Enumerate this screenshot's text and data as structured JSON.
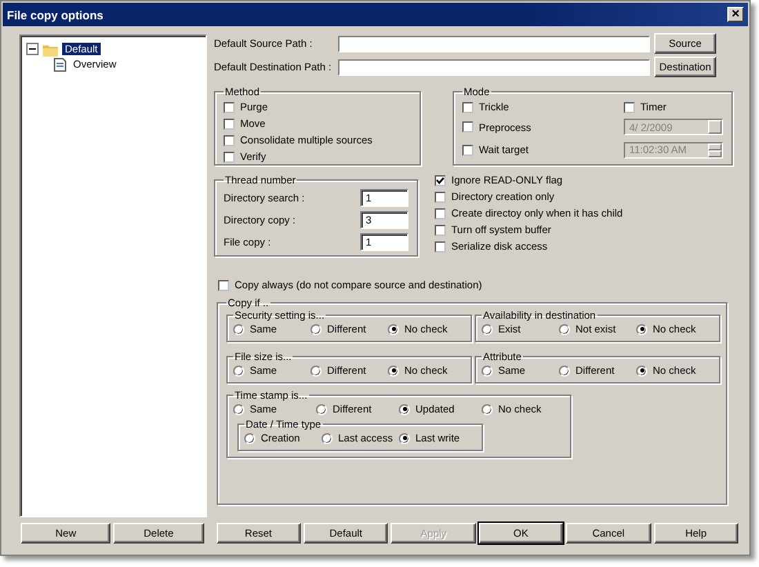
{
  "window": {
    "title": "File copy options",
    "close": "×"
  },
  "tree": [
    {
      "label": "Default",
      "selected": true,
      "expanded": true,
      "children": [
        {
          "label": "Overview",
          "selected": false
        }
      ]
    }
  ],
  "paths": [
    {
      "label": "Default Source Path :",
      "button": "Source"
    },
    {
      "label": "Default Destination Path :",
      "button": "Destination"
    }
  ],
  "method": {
    "title": "Method",
    "options": [
      {
        "label": "Purge",
        "checked": false
      },
      {
        "label": "Move",
        "checked": false
      },
      {
        "label": "Consolidate multiple sources",
        "checked": false
      },
      {
        "label": "Verify",
        "checked": false
      }
    ]
  },
  "mode": {
    "title": "Mode",
    "options": [
      {
        "label": "Trickle",
        "checked": false
      },
      {
        "label": "Preprocess",
        "checked": false
      },
      {
        "label": "Wait target",
        "checked": false
      }
    ],
    "timer": {
      "label": "Timer",
      "checked": false
    },
    "date": {
      "value": "4/  2/2009",
      "disabled": true
    },
    "time": {
      "value": "11:02:30 AM",
      "disabled": true
    }
  },
  "thread": {
    "title": "Thread number",
    "fields": [
      {
        "label": "Directory search :",
        "value": "1"
      },
      {
        "label": "Directory copy :",
        "value": "3"
      },
      {
        "label": "File copy :",
        "value": "1"
      }
    ]
  },
  "flags": [
    {
      "label": "Ignore READ-ONLY flag",
      "checked": true
    },
    {
      "label": "Directory creation only",
      "checked": false
    },
    {
      "label": "Create directoy only when it has child",
      "checked": false
    },
    {
      "label": "Turn off system buffer",
      "checked": false
    },
    {
      "label": "Serialize disk access",
      "checked": false
    }
  ],
  "copy_always": {
    "label": "Copy always (do not compare source and destination)",
    "checked": false
  },
  "copy_if": {
    "title": "Copy if ..",
    "groups": [
      {
        "title": "Security setting is...",
        "options": [
          {
            "label": "Same",
            "selected": false
          },
          {
            "label": "Different",
            "selected": false
          },
          {
            "label": "No check",
            "selected": true
          }
        ]
      },
      {
        "title": "Availability in destination",
        "options": [
          {
            "label": "Exist",
            "selected": false
          },
          {
            "label": "Not exist",
            "selected": false
          },
          {
            "label": "No check",
            "selected": true
          }
        ]
      },
      {
        "title": "File size is...",
        "options": [
          {
            "label": "Same",
            "selected": false
          },
          {
            "label": "Different",
            "selected": false
          },
          {
            "label": "No check",
            "selected": true
          }
        ]
      },
      {
        "title": "Attribute",
        "options": [
          {
            "label": "Same",
            "selected": false
          },
          {
            "label": "Different",
            "selected": false
          },
          {
            "label": "No check",
            "selected": true
          }
        ]
      }
    ],
    "timestamp": {
      "title": "Time stamp is...",
      "options": [
        {
          "label": "Same",
          "selected": false
        },
        {
          "label": "Different",
          "selected": false
        },
        {
          "label": "Updated",
          "selected": true
        },
        {
          "label": "No check",
          "selected": false
        }
      ],
      "subgroup": {
        "title": "Date / Time type",
        "options": [
          {
            "label": "Creation",
            "selected": false
          },
          {
            "label": "Last access",
            "selected": false
          },
          {
            "label": "Last write",
            "selected": true
          }
        ]
      }
    }
  },
  "left_buttons": [
    {
      "label": "New",
      "disabled": false,
      "default": false
    },
    {
      "label": "Delete",
      "disabled": false,
      "default": false
    }
  ],
  "buttons": [
    {
      "label": "Reset",
      "disabled": false,
      "default": false
    },
    {
      "label": "Default",
      "disabled": false,
      "default": false
    },
    {
      "label": "Apply",
      "disabled": true,
      "default": false
    },
    {
      "label": "OK",
      "disabled": false,
      "default": true
    },
    {
      "label": "Cancel",
      "disabled": false,
      "default": false
    },
    {
      "label": "Help",
      "disabled": false,
      "default": false
    }
  ]
}
